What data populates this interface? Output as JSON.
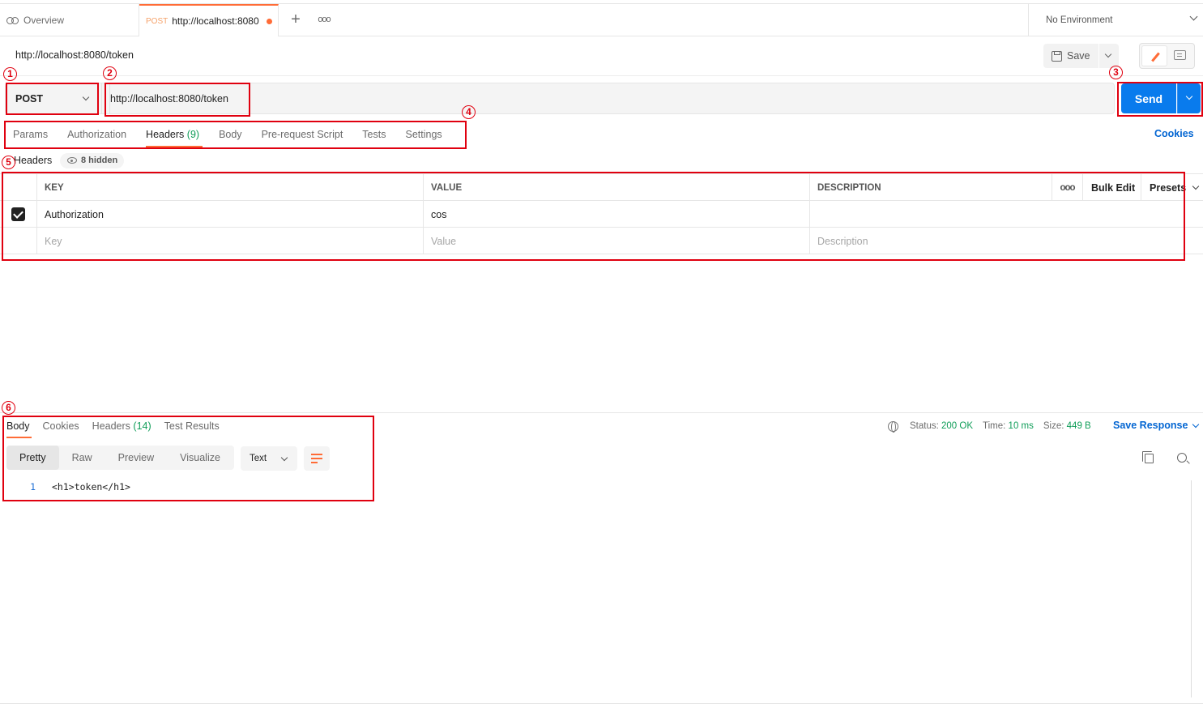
{
  "tabs": {
    "overview_label": "Overview",
    "active_method": "POST",
    "active_url": "http://localhost:8080",
    "plus_symbol": "+",
    "more_symbol": "ooo"
  },
  "environment": {
    "label": "No Environment"
  },
  "request": {
    "title": "http://localhost:8080/token",
    "save_label": "Save",
    "method": "POST",
    "url": "http://localhost:8080/token",
    "send_label": "Send"
  },
  "request_tabs": {
    "params": "Params",
    "authorization": "Authorization",
    "headers": "Headers",
    "headers_count": "(9)",
    "body": "Body",
    "prerequest": "Pre-request Script",
    "tests": "Tests",
    "settings": "Settings",
    "cookies": "Cookies"
  },
  "headers": {
    "title": "Headers",
    "hidden_label": "8 hidden",
    "columns": {
      "key": "KEY",
      "value": "VALUE",
      "description": "DESCRIPTION",
      "more": "ooo",
      "bulk_edit": "Bulk Edit",
      "presets": "Presets"
    },
    "rows": [
      {
        "checked": true,
        "key": "Authorization",
        "value": "cos",
        "description": ""
      }
    ],
    "placeholders": {
      "key": "Key",
      "value": "Value",
      "description": "Description"
    }
  },
  "response": {
    "tabs": {
      "body": "Body",
      "cookies": "Cookies",
      "headers": "Headers",
      "headers_count": "(14)",
      "test_results": "Test Results"
    },
    "status_label": "Status:",
    "status_value": "200 OK",
    "time_label": "Time:",
    "time_value": "10 ms",
    "size_label": "Size:",
    "size_value": "449 B",
    "save_response": "Save Response",
    "views": {
      "pretty": "Pretty",
      "raw": "Raw",
      "preview": "Preview",
      "visualize": "Visualize"
    },
    "format": "Text",
    "line_number": "1",
    "code": "<h1>token</h1>"
  },
  "annotations": [
    "1",
    "2",
    "3",
    "4",
    "5",
    "6"
  ],
  "colors": {
    "accent": "#ff6c37",
    "send": "#097bed",
    "annotation": "#e0000f",
    "success": "#0f9d58",
    "link": "#0265d2"
  }
}
